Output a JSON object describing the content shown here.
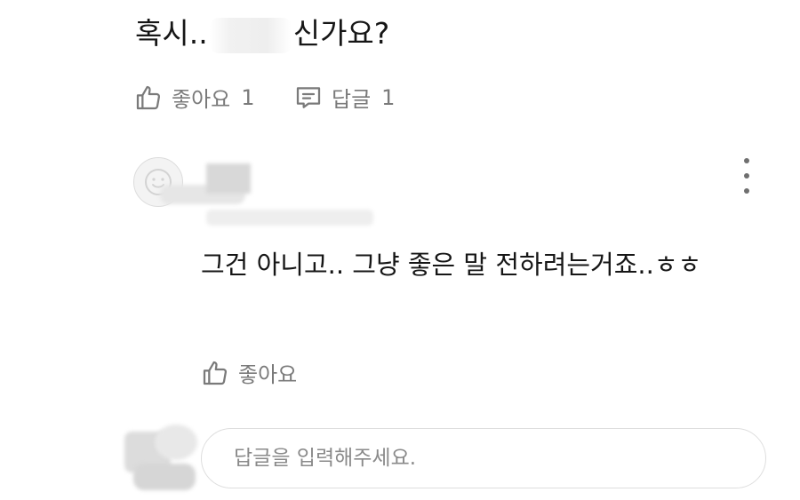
{
  "comment": {
    "text_before": "혹시..",
    "text_after": "신가요?",
    "like_label": "좋아요",
    "like_count": "1",
    "reply_label": "답글",
    "reply_count": "1"
  },
  "reply": {
    "text": "그건 아니고.. 그냥 좋은 말 전하려는거죠..ㅎㅎ",
    "like_label": "좋아요"
  },
  "reply_input": {
    "placeholder": "답글을 입력해주세요."
  },
  "colors": {
    "text": "#161616",
    "muted": "#7a7a7a",
    "border": "#dedede"
  }
}
